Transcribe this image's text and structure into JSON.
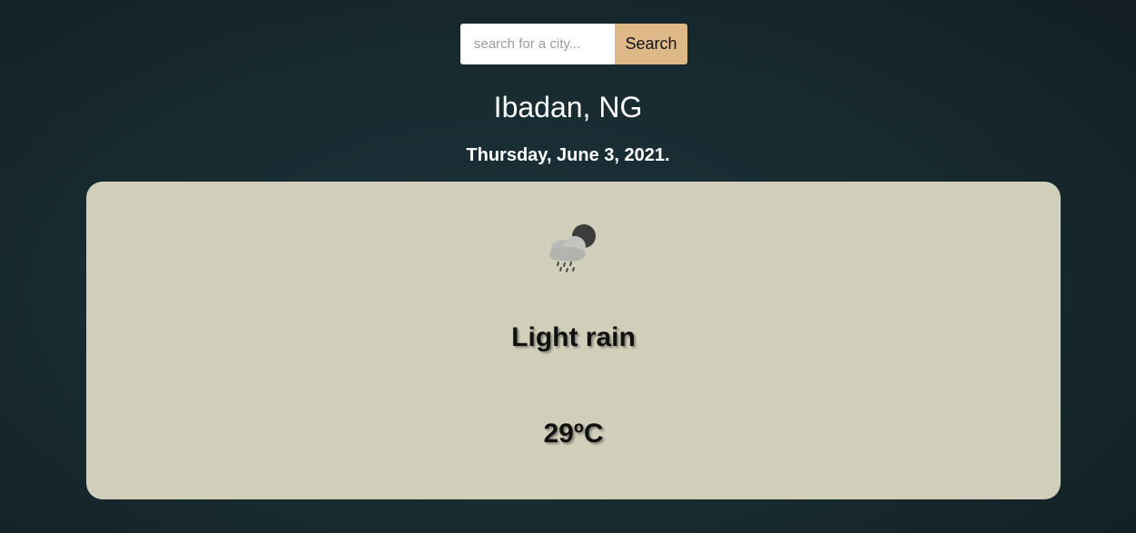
{
  "search": {
    "placeholder": "search for a city...",
    "value": "",
    "button_label": "Search"
  },
  "location": {
    "title": "Ibadan, NG",
    "date": "Thursday, June 3, 2021."
  },
  "weather": {
    "icon": "night-light-rain-icon",
    "condition": "Light rain",
    "temperature": "29ºC"
  },
  "colors": {
    "background": "#172a30",
    "card": "#d1cfba",
    "search_button": "#deb887",
    "title_text": "#ffffff",
    "card_text": "#111111"
  }
}
